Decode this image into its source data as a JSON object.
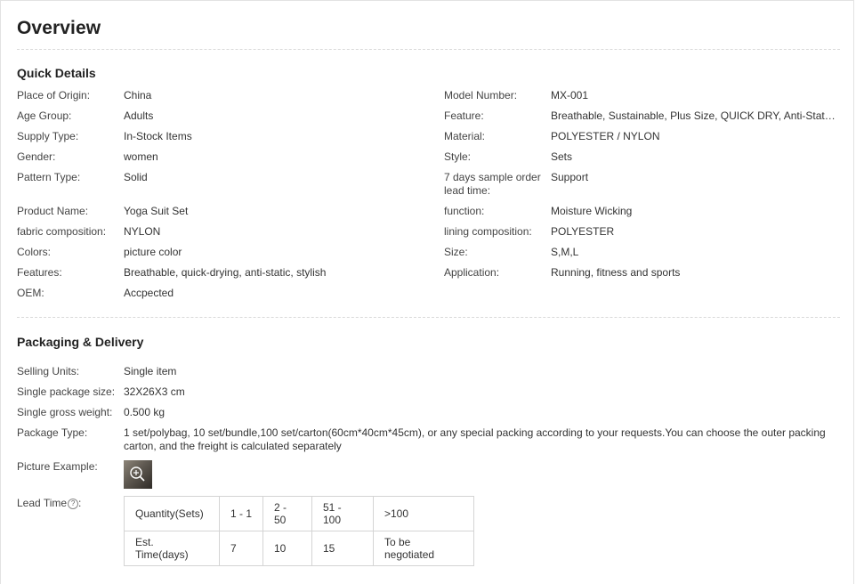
{
  "page": {
    "title": "Overview"
  },
  "quick_details": {
    "heading": "Quick Details",
    "left": [
      {
        "label": "Place of Origin:",
        "value": "China"
      },
      {
        "label": "Age Group:",
        "value": "Adults"
      },
      {
        "label": "Supply Type:",
        "value": "In-Stock Items"
      },
      {
        "label": "Gender:",
        "value": "women"
      },
      {
        "label": "Pattern Type:",
        "value": "Solid"
      },
      {
        "label": "Product Name:",
        "value": "Yoga Suit Set"
      },
      {
        "label": "fabric composition:",
        "value": "NYLON"
      },
      {
        "label": "Colors:",
        "value": "picture color"
      },
      {
        "label": "Features:",
        "value": "Breathable, quick-drying, anti-static, stylish"
      },
      {
        "label": "OEM:",
        "value": "Accpected"
      }
    ],
    "right": [
      {
        "label": "Model Number:",
        "value": "MX-001"
      },
      {
        "label": "Feature:",
        "value": "Breathable, Sustainable, Plus Size, QUICK DRY, Anti-Static, Se..."
      },
      {
        "label": "Material:",
        "value": "POLYESTER / NYLON"
      },
      {
        "label": "Style:",
        "value": "Sets"
      },
      {
        "label": "7 days sample order lead time:",
        "value": "Support"
      },
      {
        "label": "function:",
        "value": "Moisture Wicking"
      },
      {
        "label": "lining composition:",
        "value": "POLYESTER"
      },
      {
        "label": "Size:",
        "value": "S,M,L"
      },
      {
        "label": "Application:",
        "value": "Running, fitness and sports"
      }
    ]
  },
  "packaging": {
    "heading": "Packaging & Delivery",
    "rows": [
      {
        "label": "Selling Units:",
        "value": "Single item"
      },
      {
        "label": "Single package size:",
        "value": "32X26X3 cm"
      },
      {
        "label": "Single gross weight:",
        "value": "0.500 kg"
      },
      {
        "label": "Package Type:",
        "value": "1 set/polybag, 10 set/bundle,100 set/carton(60cm*40cm*45cm), or any special packing according to your requests.You can choose the outer packing carton, and the freight is calculated separately"
      }
    ],
    "picture_label": "Picture Example:",
    "lead_time_label": "Lead Time",
    "help_glyph": "?",
    "lead_table": {
      "row1": [
        "Quantity(Sets)",
        "1 - 1",
        "2 - 50",
        "51 - 100",
        ">100"
      ],
      "row2": [
        "Est. Time(days)",
        "7",
        "10",
        "15",
        "To be negotiated"
      ]
    }
  }
}
